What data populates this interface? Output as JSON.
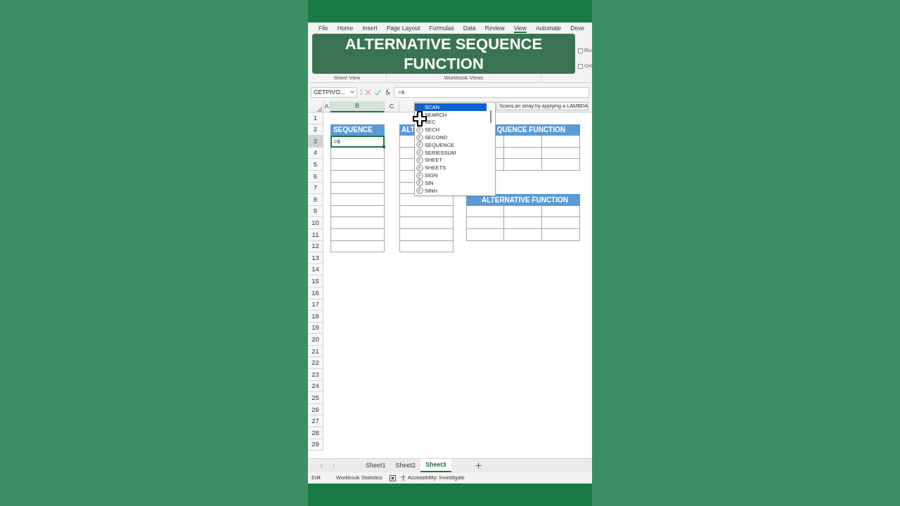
{
  "ribbon_tabs": [
    {
      "label": "File",
      "selected": false
    },
    {
      "label": "Home",
      "selected": false
    },
    {
      "label": "Insert",
      "selected": false
    },
    {
      "label": "Page Layout",
      "selected": false
    },
    {
      "label": "Formulas",
      "selected": false
    },
    {
      "label": "Data",
      "selected": false
    },
    {
      "label": "Review",
      "selected": false
    },
    {
      "label": "View",
      "selected": true
    },
    {
      "label": "Automate",
      "selected": false
    },
    {
      "label": "Deve",
      "selected": false
    }
  ],
  "ribbon_groups": [
    {
      "label": "Sheet View"
    },
    {
      "label": "Workbook Views"
    }
  ],
  "ribbon_checkboxes": [
    {
      "label": "Ru",
      "checked": false
    },
    {
      "label": "Gri",
      "checked": false
    }
  ],
  "banner": {
    "text": "ALTERNATIVE SEQUENCE FUNCTION"
  },
  "formula_bar": {
    "name_box": "GETPIVO...",
    "formula": "=s"
  },
  "column_headers": [
    {
      "label": "A",
      "selected": false
    },
    {
      "label": "B",
      "selected": true
    },
    {
      "label": "C",
      "selected": false
    }
  ],
  "rows": [
    {
      "label": "1",
      "selected": false
    },
    {
      "label": "2",
      "selected": false
    },
    {
      "label": "3",
      "selected": true
    },
    {
      "label": "4",
      "selected": false
    },
    {
      "label": "5",
      "selected": false
    },
    {
      "label": "6",
      "selected": false
    },
    {
      "label": "7",
      "selected": false
    },
    {
      "label": "8",
      "selected": false
    },
    {
      "label": "9",
      "selected": false
    },
    {
      "label": "10",
      "selected": false
    },
    {
      "label": "11",
      "selected": false
    },
    {
      "label": "12",
      "selected": false
    },
    {
      "label": "13",
      "selected": false
    },
    {
      "label": "14",
      "selected": false
    },
    {
      "label": "15",
      "selected": false
    },
    {
      "label": "16",
      "selected": false
    },
    {
      "label": "17",
      "selected": false
    },
    {
      "label": "18",
      "selected": false
    },
    {
      "label": "19",
      "selected": false
    },
    {
      "label": "20",
      "selected": false
    },
    {
      "label": "21",
      "selected": false
    },
    {
      "label": "22",
      "selected": false
    },
    {
      "label": "23",
      "selected": false
    },
    {
      "label": "24",
      "selected": false
    },
    {
      "label": "25",
      "selected": false
    },
    {
      "label": "26",
      "selected": false
    },
    {
      "label": "27",
      "selected": false
    },
    {
      "label": "28",
      "selected": false
    },
    {
      "label": "29",
      "selected": false
    }
  ],
  "tables": [
    {
      "title": "SEQUENCE",
      "active_value": "=s"
    },
    {
      "title": "ALT"
    },
    {
      "title": "QUENCE FUNCTION"
    },
    {
      "title": "ALTERNATIVE FUNCTION"
    }
  ],
  "autocomplete": {
    "items": [
      {
        "label": "SCAN",
        "selected": true
      },
      {
        "label": "SEARCH",
        "selected": false
      },
      {
        "label": "SEC",
        "selected": false
      },
      {
        "label": "SECH",
        "selected": false
      },
      {
        "label": "SECOND",
        "selected": false
      },
      {
        "label": "SEQUENCE",
        "selected": false
      },
      {
        "label": "SERIESSUM",
        "selected": false
      },
      {
        "label": "SHEET",
        "selected": false
      },
      {
        "label": "SHEETS",
        "selected": false
      },
      {
        "label": "SIGN",
        "selected": false
      },
      {
        "label": "SIN",
        "selected": false
      },
      {
        "label": "SINH",
        "selected": false
      }
    ],
    "tooltip": "Scans an array by applying a LAMBDA"
  },
  "sheet_tabs": [
    {
      "label": "Sheet1",
      "selected": false
    },
    {
      "label": "Sheet2",
      "selected": false
    },
    {
      "label": "Sheet3",
      "selected": true
    }
  ],
  "status_bar": {
    "mode": "Edit",
    "items": [
      {
        "kind": "text",
        "label": "Workbook Statistics"
      },
      {
        "kind": "accessibility",
        "label": "Accessibility: Investigate"
      }
    ]
  }
}
